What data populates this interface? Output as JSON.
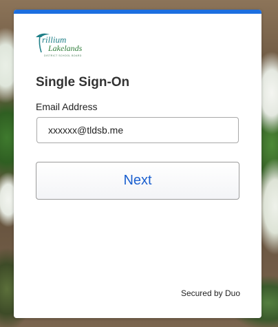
{
  "logo": {
    "name_line1": "rillium",
    "initial": "T",
    "name_line2": "Lakelands",
    "tagline": "DISTRICT SCHOOL BOARD"
  },
  "login": {
    "title": "Single Sign-On",
    "email_label": "Email Address",
    "email_value": "xxxxxx@tldsb.me",
    "next_label": "Next",
    "footer": "Secured by Duo"
  },
  "colors": {
    "accent_bar": "#1c6fe0",
    "button_text": "#1a5fcf",
    "logo_teal": "#1f7f88",
    "logo_green": "#2f7d3a"
  }
}
